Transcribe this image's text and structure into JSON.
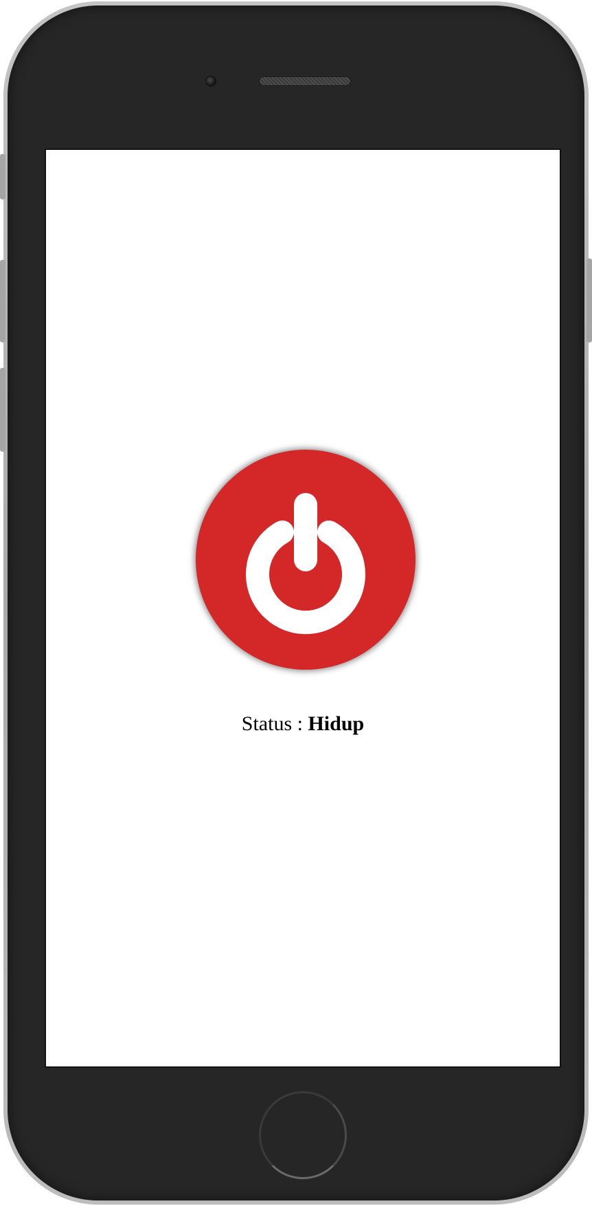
{
  "status": {
    "label": "Status : ",
    "value": "Hidup"
  },
  "power_button": {
    "icon": "power-icon",
    "color": "#d42727",
    "icon_color": "#ffffff"
  },
  "device": {
    "frame_color": "#262626",
    "screen_color": "#ffffff"
  }
}
